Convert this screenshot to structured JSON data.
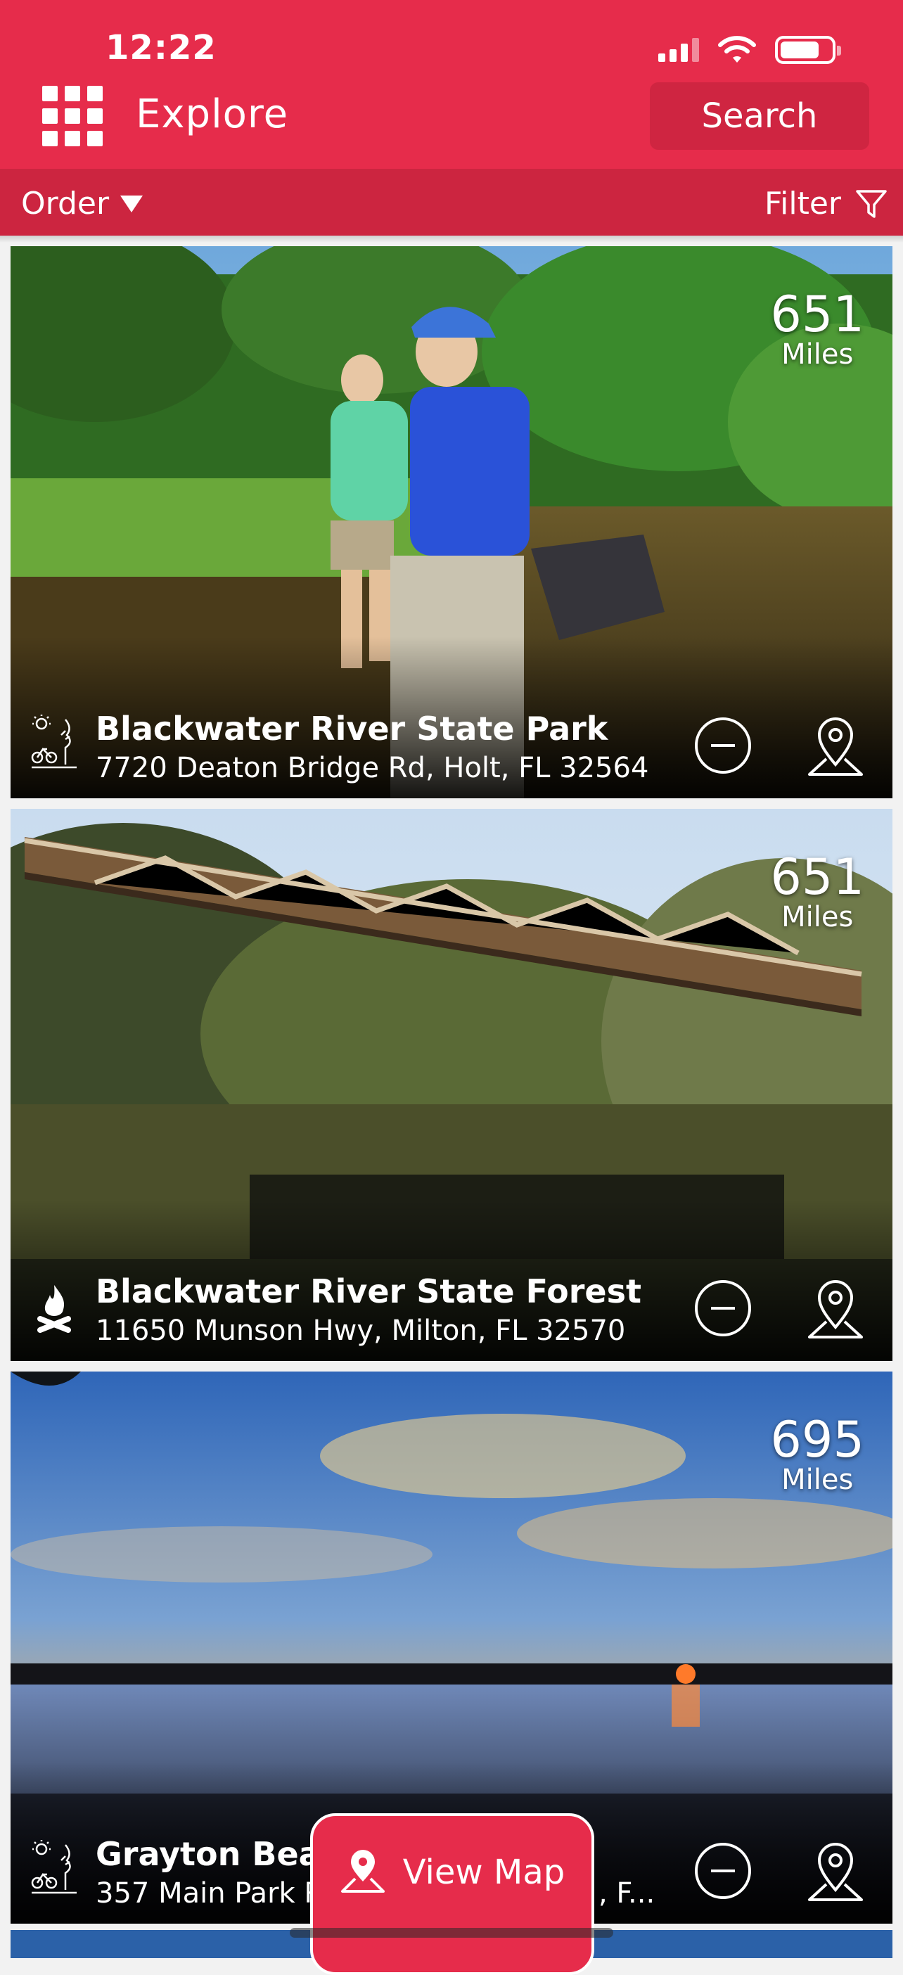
{
  "status_bar": {
    "time": "12:22"
  },
  "header": {
    "title": "Explore",
    "search_label": "Search",
    "menu_icon": "grid-icon"
  },
  "toolbar": {
    "order_label": "Order",
    "filter_label": "Filter"
  },
  "cards": [
    {
      "name": "Blackwater River State Park",
      "address": "7720 Deaton Bridge Rd, Holt, FL 32564",
      "distance": "651",
      "distance_unit": "Miles",
      "category_icon": "park-activities-icon"
    },
    {
      "name": "Blackwater River State Forest",
      "address": "11650 Munson Hwy, Milton, FL 32570",
      "distance": "651",
      "distance_unit": "Miles",
      "category_icon": "campfire-icon"
    },
    {
      "name": "Grayton Beac",
      "address": "357 Main Park R",
      "address_tail": ", F...",
      "distance": "695",
      "distance_unit": "Miles",
      "category_icon": "park-activities-icon"
    }
  ],
  "view_map": {
    "label": "View Map"
  },
  "colors": {
    "brand": "#e62c4b",
    "brand_dark": "#cc2540"
  }
}
